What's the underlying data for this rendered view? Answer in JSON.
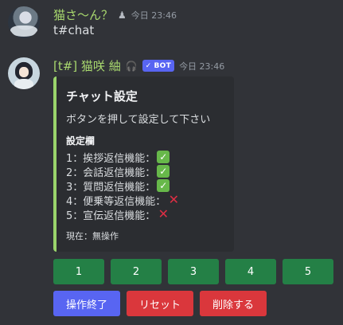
{
  "message1": {
    "username": "猫さ〜ん？",
    "timestamp": "今日 23:46",
    "content": "t#chat"
  },
  "message2": {
    "username": "[t#] 猫咲 紬",
    "badge_label": "BOT",
    "timestamp": "今日 23:46",
    "embed": {
      "accent_color": "#9ad46b",
      "title": "チャット設定",
      "description": "ボタンを押して設定して下さい",
      "field_name": "設定欄",
      "settings": [
        {
          "label": "1：挨拶返信機能：",
          "enabled": true
        },
        {
          "label": "2：会話返信機能：",
          "enabled": true
        },
        {
          "label": "3：質問返信機能：",
          "enabled": true
        },
        {
          "label": "4：便乗等返信機能：",
          "enabled": false
        },
        {
          "label": "5：宣伝返信機能：",
          "enabled": false
        }
      ],
      "footer": "現在：無操作"
    },
    "number_buttons": [
      "1",
      "2",
      "3",
      "4",
      "5"
    ],
    "action_buttons": {
      "finish": "操作終了",
      "reset": "リセット",
      "delete": "削除する"
    }
  },
  "colors": {
    "background": "#313338",
    "name_green": "#a8d86e",
    "button_green": "#248046",
    "button_blurple": "#5865f2",
    "button_red": "#da373c"
  }
}
